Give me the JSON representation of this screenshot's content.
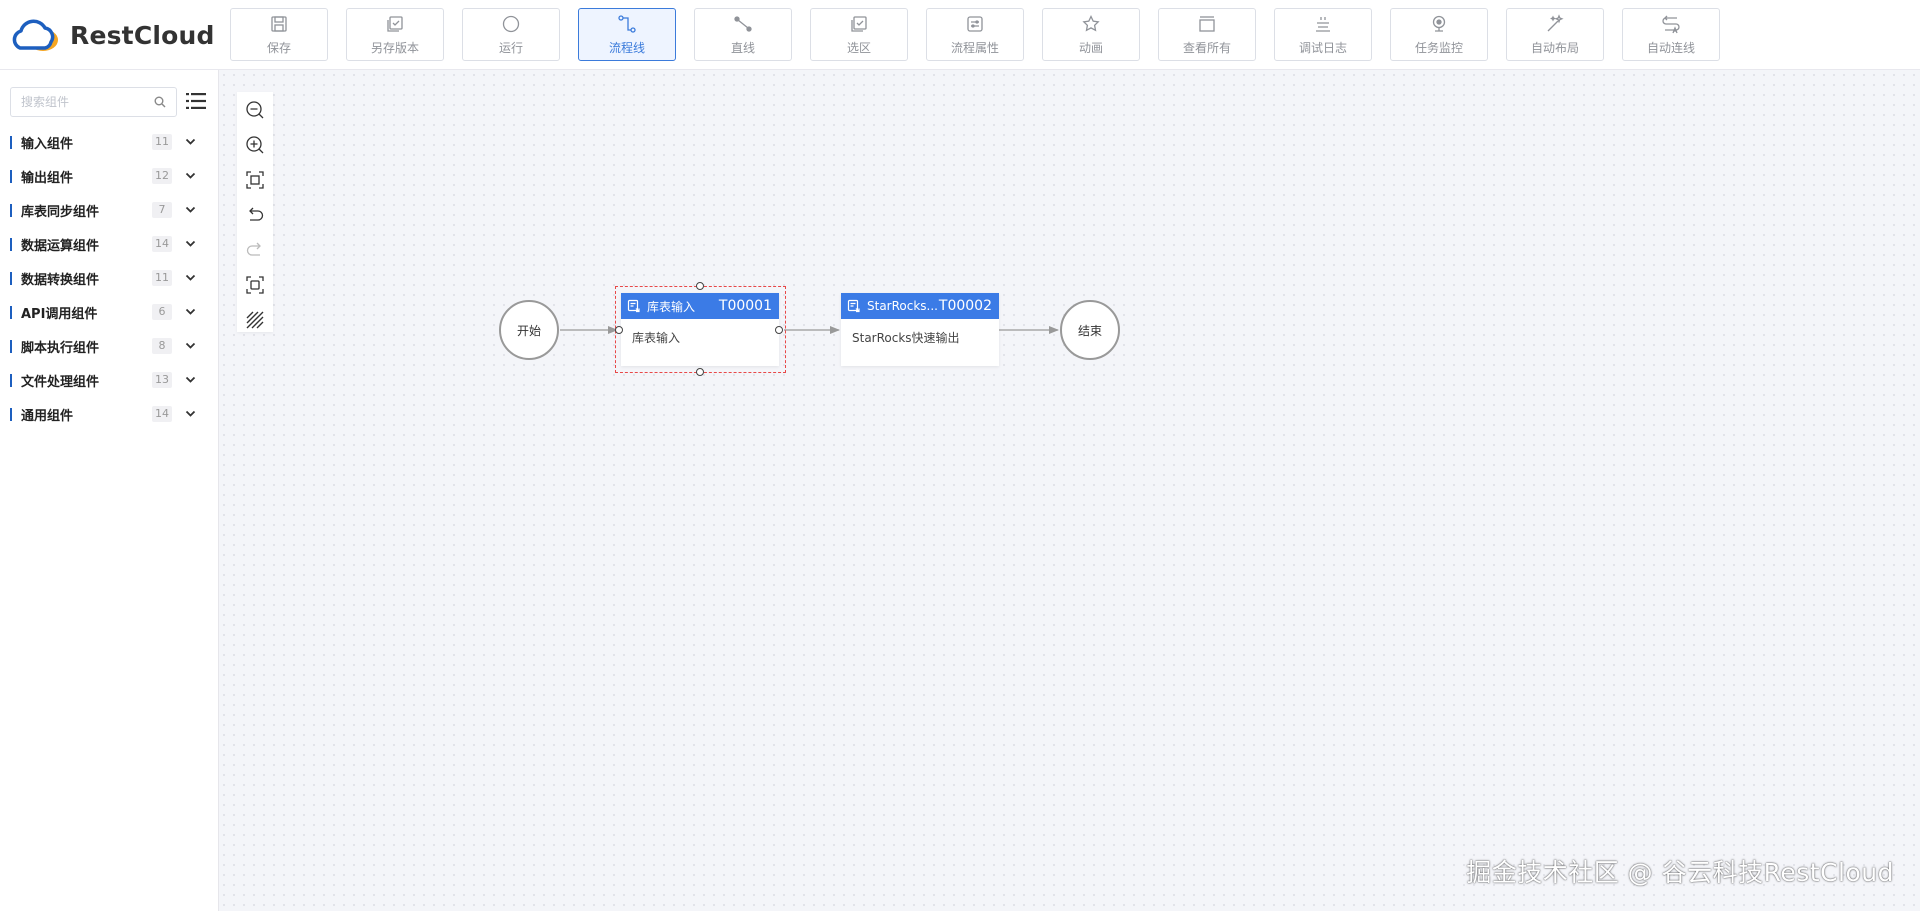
{
  "brand": {
    "name": "RestCloud"
  },
  "toolbar": [
    {
      "label": "保存",
      "icon": "save-icon"
    },
    {
      "label": "另存版本",
      "icon": "save-version-icon"
    },
    {
      "label": "运行",
      "icon": "run-icon"
    },
    {
      "label": "流程线",
      "icon": "flow-line-icon",
      "active": true
    },
    {
      "label": "直线",
      "icon": "straight-line-icon"
    },
    {
      "label": "选区",
      "icon": "select-area-icon"
    },
    {
      "label": "流程属性",
      "icon": "flow-properties-icon"
    },
    {
      "label": "动画",
      "icon": "animation-icon"
    },
    {
      "label": "查看所有",
      "icon": "view-all-icon"
    },
    {
      "label": "调试日志",
      "icon": "debug-log-icon"
    },
    {
      "label": "任务监控",
      "icon": "task-monitor-icon"
    },
    {
      "label": "自动布局",
      "icon": "auto-layout-icon"
    },
    {
      "label": "自动连线",
      "icon": "auto-connect-icon"
    }
  ],
  "sidebar": {
    "search_placeholder": "搜索组件",
    "categories": [
      {
        "name": "输入组件",
        "count": "11"
      },
      {
        "name": "输出组件",
        "count": "12"
      },
      {
        "name": "库表同步组件",
        "count": "7"
      },
      {
        "name": "数据运算组件",
        "count": "14"
      },
      {
        "name": "数据转换组件",
        "count": "11"
      },
      {
        "name": "API调用组件",
        "count": "6"
      },
      {
        "name": "脚本执行组件",
        "count": "8"
      },
      {
        "name": "文件处理组件",
        "count": "13"
      },
      {
        "name": "通用组件",
        "count": "14"
      }
    ]
  },
  "canvas_tools": [
    "zoom-out-icon",
    "zoom-in-icon",
    "fit-view-icon",
    "undo-icon",
    "redo-icon",
    "fullscreen-icon",
    "grid-toggle-icon"
  ],
  "flow": {
    "start_label": "开始",
    "end_label": "结束",
    "tasks": [
      {
        "title": "库表输入",
        "id": "T00001",
        "desc": "库表输入",
        "selected": true
      },
      {
        "title": "StarRocks...",
        "id": "T00002",
        "desc": "StarRocks快速输出",
        "selected": false
      }
    ]
  },
  "watermark": "掘金技术社区 @ 谷云科技RestCloud",
  "colors": {
    "accent": "#3b7be6",
    "selection": "#e84848",
    "brand_blue": "#1d5fbf",
    "brand_orange": "#f5a623"
  }
}
